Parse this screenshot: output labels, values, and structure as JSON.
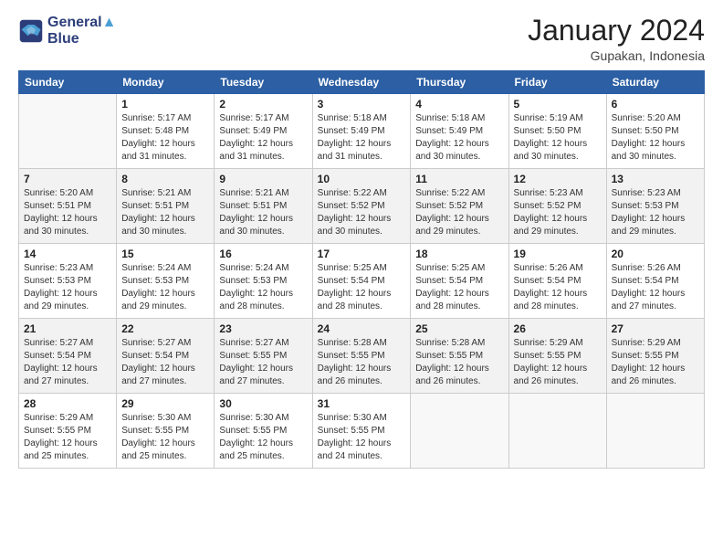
{
  "header": {
    "logo": {
      "line1": "General",
      "line2": "Blue"
    },
    "title": "January 2024",
    "subtitle": "Gupakan, Indonesia"
  },
  "calendar": {
    "days_of_week": [
      "Sunday",
      "Monday",
      "Tuesday",
      "Wednesday",
      "Thursday",
      "Friday",
      "Saturday"
    ],
    "weeks": [
      [
        {
          "day": "",
          "info": ""
        },
        {
          "day": "1",
          "info": "Sunrise: 5:17 AM\nSunset: 5:48 PM\nDaylight: 12 hours\nand 31 minutes."
        },
        {
          "day": "2",
          "info": "Sunrise: 5:17 AM\nSunset: 5:49 PM\nDaylight: 12 hours\nand 31 minutes."
        },
        {
          "day": "3",
          "info": "Sunrise: 5:18 AM\nSunset: 5:49 PM\nDaylight: 12 hours\nand 31 minutes."
        },
        {
          "day": "4",
          "info": "Sunrise: 5:18 AM\nSunset: 5:49 PM\nDaylight: 12 hours\nand 30 minutes."
        },
        {
          "day": "5",
          "info": "Sunrise: 5:19 AM\nSunset: 5:50 PM\nDaylight: 12 hours\nand 30 minutes."
        },
        {
          "day": "6",
          "info": "Sunrise: 5:20 AM\nSunset: 5:50 PM\nDaylight: 12 hours\nand 30 minutes."
        }
      ],
      [
        {
          "day": "7",
          "info": "Sunrise: 5:20 AM\nSunset: 5:51 PM\nDaylight: 12 hours\nand 30 minutes."
        },
        {
          "day": "8",
          "info": "Sunrise: 5:21 AM\nSunset: 5:51 PM\nDaylight: 12 hours\nand 30 minutes."
        },
        {
          "day": "9",
          "info": "Sunrise: 5:21 AM\nSunset: 5:51 PM\nDaylight: 12 hours\nand 30 minutes."
        },
        {
          "day": "10",
          "info": "Sunrise: 5:22 AM\nSunset: 5:52 PM\nDaylight: 12 hours\nand 30 minutes."
        },
        {
          "day": "11",
          "info": "Sunrise: 5:22 AM\nSunset: 5:52 PM\nDaylight: 12 hours\nand 29 minutes."
        },
        {
          "day": "12",
          "info": "Sunrise: 5:23 AM\nSunset: 5:52 PM\nDaylight: 12 hours\nand 29 minutes."
        },
        {
          "day": "13",
          "info": "Sunrise: 5:23 AM\nSunset: 5:53 PM\nDaylight: 12 hours\nand 29 minutes."
        }
      ],
      [
        {
          "day": "14",
          "info": "Sunrise: 5:23 AM\nSunset: 5:53 PM\nDaylight: 12 hours\nand 29 minutes."
        },
        {
          "day": "15",
          "info": "Sunrise: 5:24 AM\nSunset: 5:53 PM\nDaylight: 12 hours\nand 29 minutes."
        },
        {
          "day": "16",
          "info": "Sunrise: 5:24 AM\nSunset: 5:53 PM\nDaylight: 12 hours\nand 28 minutes."
        },
        {
          "day": "17",
          "info": "Sunrise: 5:25 AM\nSunset: 5:54 PM\nDaylight: 12 hours\nand 28 minutes."
        },
        {
          "day": "18",
          "info": "Sunrise: 5:25 AM\nSunset: 5:54 PM\nDaylight: 12 hours\nand 28 minutes."
        },
        {
          "day": "19",
          "info": "Sunrise: 5:26 AM\nSunset: 5:54 PM\nDaylight: 12 hours\nand 28 minutes."
        },
        {
          "day": "20",
          "info": "Sunrise: 5:26 AM\nSunset: 5:54 PM\nDaylight: 12 hours\nand 27 minutes."
        }
      ],
      [
        {
          "day": "21",
          "info": "Sunrise: 5:27 AM\nSunset: 5:54 PM\nDaylight: 12 hours\nand 27 minutes."
        },
        {
          "day": "22",
          "info": "Sunrise: 5:27 AM\nSunset: 5:54 PM\nDaylight: 12 hours\nand 27 minutes."
        },
        {
          "day": "23",
          "info": "Sunrise: 5:27 AM\nSunset: 5:55 PM\nDaylight: 12 hours\nand 27 minutes."
        },
        {
          "day": "24",
          "info": "Sunrise: 5:28 AM\nSunset: 5:55 PM\nDaylight: 12 hours\nand 26 minutes."
        },
        {
          "day": "25",
          "info": "Sunrise: 5:28 AM\nSunset: 5:55 PM\nDaylight: 12 hours\nand 26 minutes."
        },
        {
          "day": "26",
          "info": "Sunrise: 5:29 AM\nSunset: 5:55 PM\nDaylight: 12 hours\nand 26 minutes."
        },
        {
          "day": "27",
          "info": "Sunrise: 5:29 AM\nSunset: 5:55 PM\nDaylight: 12 hours\nand 26 minutes."
        }
      ],
      [
        {
          "day": "28",
          "info": "Sunrise: 5:29 AM\nSunset: 5:55 PM\nDaylight: 12 hours\nand 25 minutes."
        },
        {
          "day": "29",
          "info": "Sunrise: 5:30 AM\nSunset: 5:55 PM\nDaylight: 12 hours\nand 25 minutes."
        },
        {
          "day": "30",
          "info": "Sunrise: 5:30 AM\nSunset: 5:55 PM\nDaylight: 12 hours\nand 25 minutes."
        },
        {
          "day": "31",
          "info": "Sunrise: 5:30 AM\nSunset: 5:55 PM\nDaylight: 12 hours\nand 24 minutes."
        },
        {
          "day": "",
          "info": ""
        },
        {
          "day": "",
          "info": ""
        },
        {
          "day": "",
          "info": ""
        }
      ]
    ]
  }
}
